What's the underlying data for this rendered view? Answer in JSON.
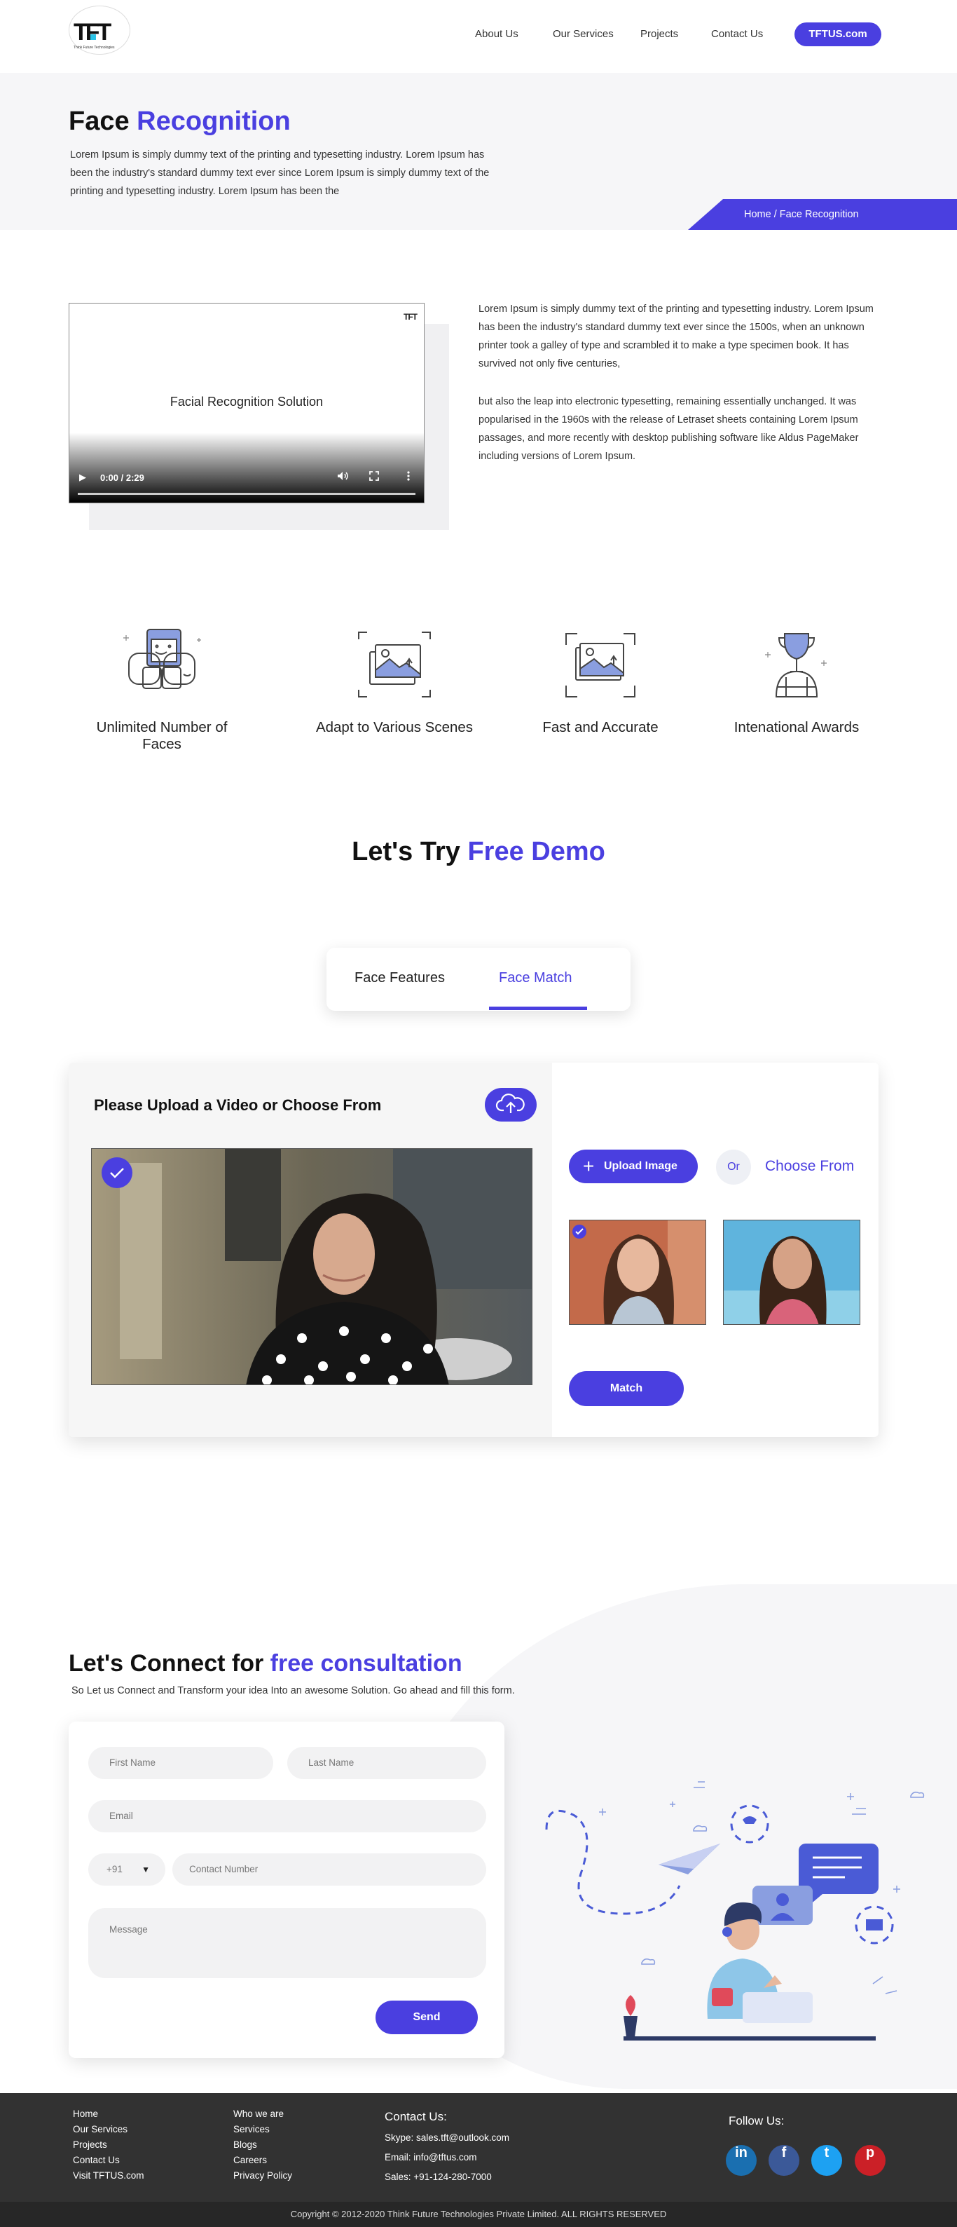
{
  "header": {
    "logo_text": "TFT",
    "logo_sub": "Think Future Technologies",
    "nav": [
      "About Us",
      "Our Services",
      "Projects",
      "Contact Us"
    ],
    "cta": "TFTUS.com"
  },
  "banner": {
    "title_plain": "Face ",
    "title_accent": "Recognition",
    "description": "Lorem Ipsum is simply dummy text of the printing and typesetting industry. Lorem Ipsum has been the industry's standard dummy text ever since Lorem Ipsum is simply dummy text of the printing and typesetting industry. Lorem Ipsum has been the",
    "breadcrumb": "Home / Face Recognition"
  },
  "video": {
    "title": "Facial Recognition Solution",
    "logo": "TFT",
    "time": "0:00 / 2:29",
    "progress": 0
  },
  "intro": {
    "para1": "Lorem Ipsum is simply dummy text of the printing and typesetting industry. Lorem Ipsum has been the industry's standard dummy text ever since the 1500s, when an unknown printer took a galley of type and scrambled it to make a type specimen book. It has survived not only five centuries,",
    "para2": "but also the leap into electronic typesetting, remaining essentially unchanged. It was popularised in the 1960s with the release of Letraset sheets containing Lorem Ipsum passages, and more recently with desktop publishing software like Aldus PageMaker including versions of Lorem Ipsum."
  },
  "features": [
    {
      "label": "Unlimited Number of Faces",
      "icon": "faces-icon"
    },
    {
      "label": "Adapt to Various Scenes",
      "icon": "scene-icon"
    },
    {
      "label": "Fast and Accurate",
      "icon": "photo-scan-icon"
    },
    {
      "label": "Intenational Awards",
      "icon": "trophy-icon"
    }
  ],
  "demo": {
    "title_plain": "Let's Try ",
    "title_accent": "Free Demo",
    "tabs": [
      "Face Features",
      "Face Match"
    ],
    "active_tab": "Face Match",
    "upload_title": "Please Upload a Video or Choose From",
    "upload_button": "Upload Image",
    "or": "Or",
    "choose_from": "Choose From",
    "match_button": "Match"
  },
  "connect": {
    "title_plain": "Let's Connect for ",
    "title_accent": "free consultation",
    "subtitle": "So Let us Connect and Transform your idea Into an awesome Solution. Go ahead and fill this form.",
    "fields": {
      "first_name": "First Name",
      "last_name": "Last Name",
      "email": "Email",
      "country_code": "+91",
      "contact": "Contact Number",
      "message": "Message"
    },
    "send": "Send"
  },
  "footer": {
    "col1": [
      "Home",
      "Our Services",
      "Projects",
      "Contact Us",
      "Visit TFTUS.com"
    ],
    "col2": [
      "Who we are",
      "Services",
      "Blogs",
      "Careers",
      "Privacy Policy"
    ],
    "contact_title": "Contact Us:",
    "skype": "Skype: sales.tft@outlook.com",
    "email": "Email: info@tftus.com",
    "sales": "Sales: +91-124-280-7000",
    "follow": "Follow Us:",
    "social": [
      "in",
      "f",
      "t",
      "p"
    ],
    "social_colors": [
      "#1a6fb0",
      "#3b5998",
      "#1da1f2",
      "#cb2027"
    ],
    "copyright": "Copyright © 2012-2020 Think Future Technologies Private Limited. ALL RIGHTS RESERVED"
  },
  "colors": {
    "accent": "#4a3fe0",
    "footer_bg": "#323232"
  }
}
